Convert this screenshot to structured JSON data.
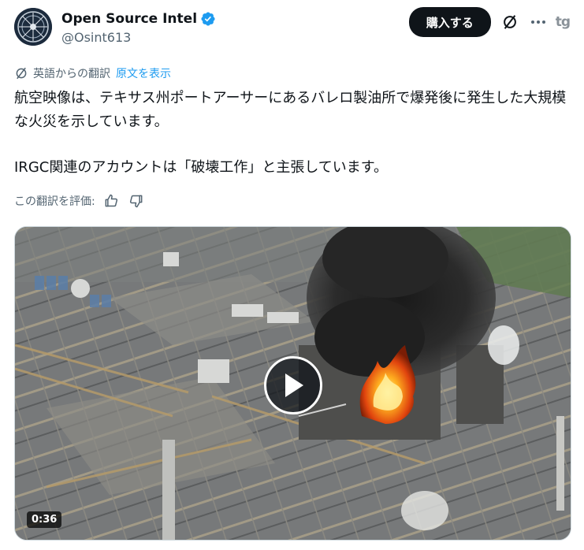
{
  "tweet": {
    "author": {
      "display_name": "Open Source Intel",
      "handle": "@Osint613",
      "verified": true,
      "avatar_icon": "compass-emblem-avatar"
    },
    "actions": {
      "buy_label": "購入する",
      "grok_icon": "grok-icon",
      "more_icon": "more-dots-icon",
      "extension_badge": "tg"
    },
    "translation": {
      "label": "英語からの翻訳",
      "show_original": "原文を表示",
      "icon": "globe-icon"
    },
    "text": {
      "line1": "航空映像は、テキサス州ポートアーサーにあるバレロ製油所で爆発後に発生した大規模な火災を示しています。",
      "line2": "IRGC関連のアカウントは「破壊工作」と主張しています。"
    },
    "rate": {
      "label": "この翻訳を評価:",
      "thumbs_up_icon": "thumbs-up-icon",
      "thumbs_down_icon": "thumbs-down-icon"
    },
    "video": {
      "duration": "0:36",
      "play_icon": "play-icon"
    }
  },
  "colors": {
    "accent_link": "#1d9bf0",
    "verified_badge": "#1d9bf0",
    "secondary_text": "#536471",
    "button_dark": "#0f1419"
  }
}
